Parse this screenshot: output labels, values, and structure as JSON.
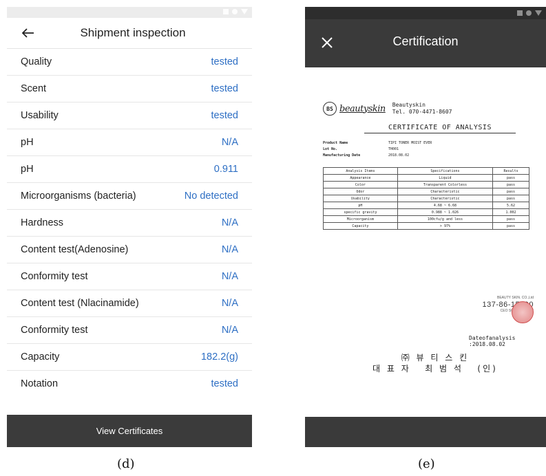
{
  "left": {
    "title": "Shipment inspection",
    "rows": [
      {
        "label": "Quality",
        "value": "tested"
      },
      {
        "label": "Scent",
        "value": "tested"
      },
      {
        "label": "Usability",
        "value": "tested"
      },
      {
        "label": "pH",
        "value": "N/A"
      },
      {
        "label": "pH",
        "value": "0.911"
      },
      {
        "label": "Microorganisms (bacteria)",
        "value": "No detected"
      },
      {
        "label": "Hardness",
        "value": "N/A"
      },
      {
        "label": "Content test(Adenosine)",
        "value": "N/A"
      },
      {
        "label": "Conformity test",
        "value": "N/A"
      },
      {
        "label": "Content test (Nlacinamide)",
        "value": "N/A"
      },
      {
        "label": "Conformity test",
        "value": "N/A"
      },
      {
        "label": "Capacity",
        "value": "182.2(g)"
      },
      {
        "label": "Notation",
        "value": "tested"
      }
    ],
    "button_label": "View Certificates",
    "caption": "(d)"
  },
  "right": {
    "title": "Certification",
    "caption": "(e)",
    "certificate": {
      "logo_text": "beautyskin",
      "logo_mark": "BS",
      "company_name": "Beautyskin",
      "company_tel": "Tel. 070-4471-8607",
      "doc_title": "CERTIFICATE OF ANALYSIS",
      "info": [
        {
          "key": "Product Name",
          "value": "TIPI TONER MOIST EVER"
        },
        {
          "key": "Lot No.",
          "value": "TH001"
        },
        {
          "key": "Manufacturing Date",
          "value": "2018.08.02"
        }
      ],
      "table_headers": [
        "Analysis Items",
        "Specifications",
        "Results"
      ],
      "table_rows": [
        [
          "Appearance",
          "Liquid",
          "pass"
        ],
        [
          "Color",
          "Transparent Colorless",
          "pass"
        ],
        [
          "Odor",
          "Characteristic",
          "pass"
        ],
        [
          "Usability",
          "Characteristic",
          "pass"
        ],
        [
          "pH",
          "4.68 ~ 6.68",
          "5.62"
        ],
        [
          "specific gravity",
          "0.988 ~ 1.026",
          "1.002"
        ],
        [
          "Microorganism",
          "100cfu/g and less",
          "pass"
        ],
        [
          "Capacity",
          "> 97%",
          "pass"
        ]
      ],
      "stamp_company": "BEAUTY SKIN. CO.,Ltd",
      "stamp_number": "137-86-15890",
      "stamp_ceo": "CEO SUN SUK CHOI",
      "date_line": "Dateofanalysis :2018.08.02",
      "korean_company": "㈜ 뷰 티 스 킨",
      "korean_ceo": "대 표 자   최 범 석   (인)"
    }
  },
  "colors": {
    "accent": "#2e6fc4",
    "dark_bar": "#3a3a3a",
    "light_status": "#ececec"
  }
}
